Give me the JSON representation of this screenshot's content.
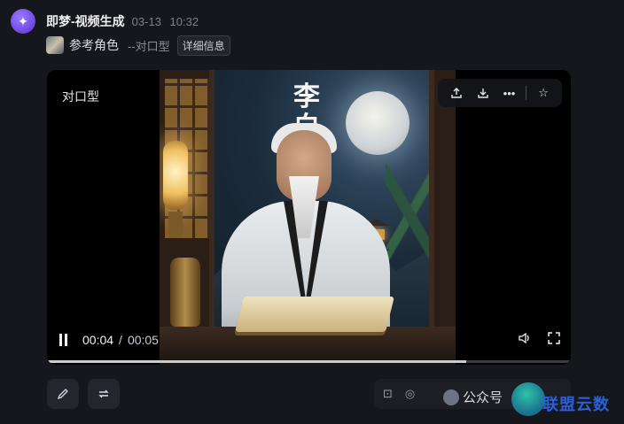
{
  "header": {
    "app_name": "即梦-视频生成",
    "date": "03-13",
    "time": "10:32",
    "logo_icon": "jimeng-logo-icon"
  },
  "sub": {
    "ref_label": "参考角色",
    "mode_label": "--对口型",
    "detail_button": "详细信息"
  },
  "card": {
    "label": "对口型",
    "video_title_text": "李白",
    "toolbar": {
      "icons": [
        "share-icon",
        "download-icon",
        "more-icon",
        "star-icon"
      ]
    },
    "player": {
      "current_time": "00:04",
      "separator": "/",
      "total_time": "00:05",
      "progress": 0.8,
      "icons": [
        "pause-icon",
        "volume-icon",
        "fullscreen-icon"
      ]
    }
  },
  "actions": {
    "icons": [
      "edit-icon",
      "regenerate-icon"
    ]
  },
  "watermark": {
    "text": "公众号",
    "brand": "联盟云数"
  }
}
